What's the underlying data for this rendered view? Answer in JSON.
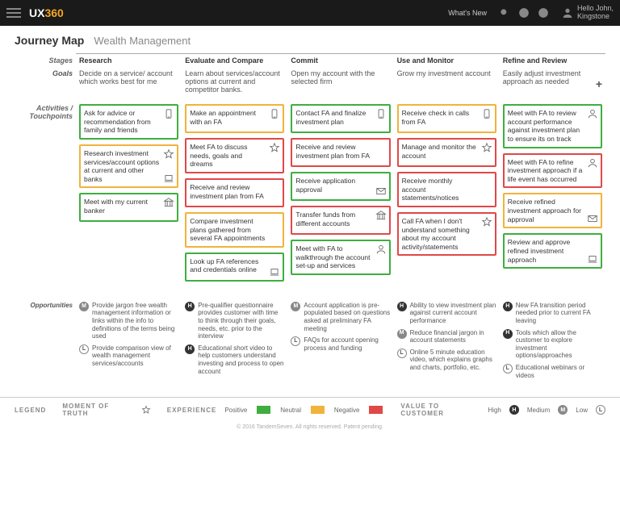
{
  "topbar": {
    "logo_a": "UX",
    "logo_b": "360",
    "whats_new": "What's New",
    "user_line1": "Hello John,",
    "user_line2": "Kingstone"
  },
  "title": "Journey Map",
  "subtitle": "Wealth Management",
  "rows": {
    "stages": "Stages",
    "goals": "Goals",
    "activities": "Activities /\nTouchpoints",
    "opps": "Opportunities"
  },
  "stages": [
    "Research",
    "Evaluate and Compare",
    "Commit",
    "Use and Monitor",
    "Refine and Review"
  ],
  "goals": [
    "Decide on a service/ account which works best for me",
    "Learn about services/account options at current and competitor banks.",
    "Open my account with the selected firm",
    "Grow my investment account",
    "Easily adjust investment approach as needed"
  ],
  "cards": [
    [
      {
        "c": "green",
        "t": "Ask for advice or recommendation from family and friends",
        "i": "phone"
      },
      {
        "c": "yellow",
        "t": "Research investment services/account options at current and other banks",
        "i": "star",
        "i2": "laptop"
      },
      {
        "c": "green",
        "t": "Meet with my current banker",
        "i": "bank"
      }
    ],
    [
      {
        "c": "yellow",
        "t": "Make an appointment with an FA",
        "i": "phone"
      },
      {
        "c": "red",
        "t": "Meet FA to discuss needs, goals and dreams",
        "i": "star"
      },
      {
        "c": "red",
        "t": "Receive and review investment plan from FA"
      },
      {
        "c": "yellow",
        "t": "Compare investment plans gathered from several FA appointments"
      },
      {
        "c": "green",
        "t": "Look up FA references and credentials online",
        "i2": "laptop"
      }
    ],
    [
      {
        "c": "green",
        "t": "Contact FA and finalize investment plan",
        "i": "phone"
      },
      {
        "c": "red",
        "t": "Receive and review investment plan from FA"
      },
      {
        "c": "green",
        "t": "Receive application approval",
        "i2": "mail"
      },
      {
        "c": "red",
        "t": "Transfer funds from different accounts",
        "i": "bank"
      },
      {
        "c": "green",
        "t": "Meet with FA to walkthrough the account set-up and services",
        "i": "person"
      }
    ],
    [
      {
        "c": "yellow",
        "t": "Receive check in calls from FA",
        "i": "phone"
      },
      {
        "c": "red",
        "t": "Manage and monitor the account",
        "i": "star"
      },
      {
        "c": "red",
        "t": "Receive monthly account statements/notices"
      },
      {
        "c": "red",
        "t": "Call FA when I don't understand something about my account activity/statements",
        "i": "star"
      }
    ],
    [
      {
        "c": "green",
        "t": "Meet with FA to review account performance against investment plan to ensure its on track",
        "i": "person"
      },
      {
        "c": "red",
        "t": "Meet with FA to refine investment approach if a life event has occurred",
        "i": "person"
      },
      {
        "c": "yellow",
        "t": "Receive refined investment approach for approval",
        "i2": "mail"
      },
      {
        "c": "green",
        "t": "Review and approve refined investment approach",
        "i2": "laptop"
      }
    ]
  ],
  "opps": [
    [
      {
        "b": "M",
        "t": "Provide jargon free wealth management information or links within the info to definitions of the terms being used"
      },
      {
        "b": "L",
        "t": "Provide comparison view of wealth management services/accounts"
      }
    ],
    [
      {
        "b": "H",
        "t": "Pre-qualifier questionnaire provides customer with time to think through their goals, needs, etc. prior to the interview"
      },
      {
        "b": "H",
        "t": "Educational short video to help customers understand investing and process to open account"
      }
    ],
    [
      {
        "b": "M",
        "t": "Account application is pre-populated based on questions asked at preliminary FA meeting"
      },
      {
        "b": "L",
        "t": "FAQs for account opening process and funding"
      }
    ],
    [
      {
        "b": "H",
        "t": "Ability to view investment plan against current account performance"
      },
      {
        "b": "M",
        "t": "Reduce financial jargon in account statements"
      },
      {
        "b": "L",
        "t": "Online 5 minute education video, which explains graphs and charts, portfolio, etc."
      }
    ],
    [
      {
        "b": "H",
        "t": "New FA transition period needed prior to current FA leaving"
      },
      {
        "b": "H",
        "t": "Tools which allow the customer to explore investment options/approaches"
      },
      {
        "b": "L",
        "t": "Educational webinars or videos"
      }
    ]
  ],
  "legend": {
    "title": "LEGEND",
    "moment": "MOMENT OF TRUTH",
    "experience": "EXPERIENCE",
    "pos": "Positive",
    "neu": "Neutral",
    "neg": "Negative",
    "value": "VALUE TO CUSTOMER",
    "high": "High",
    "med": "Medium",
    "low": "Low"
  },
  "footer": "© 2016 TandemSeven. All rights reserved. Patent pending."
}
